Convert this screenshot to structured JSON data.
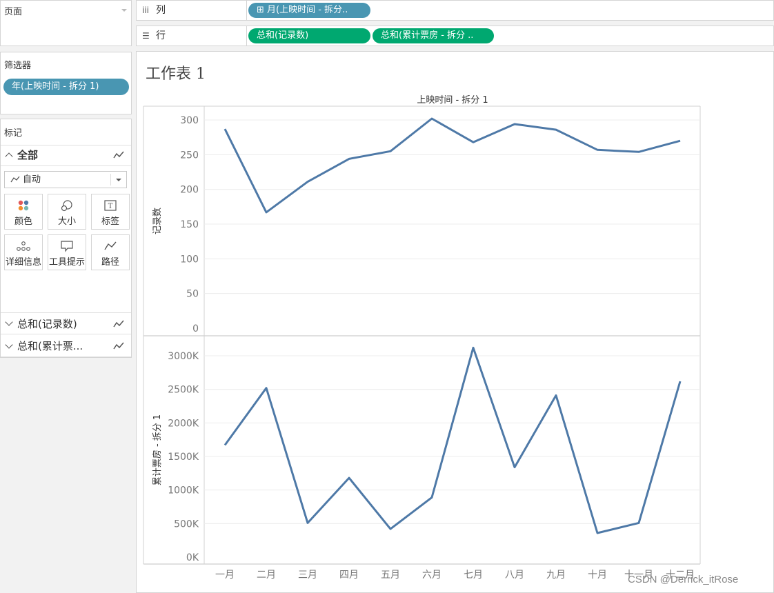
{
  "left_panel": {
    "pages_title": "页面",
    "filters_title": "筛选器",
    "filter_pill": "年(上映时间 - 拆分 1)",
    "marks_title": "标记",
    "all_label": "全部",
    "mark_type": "自动",
    "buttons": [
      "颜色",
      "大小",
      "标签",
      "详细信息",
      "工具提示",
      "路径"
    ],
    "measure_rows": [
      "总和(记录数)",
      "总和(累计票..."
    ]
  },
  "shelves": {
    "columns_label": "列",
    "columns_pill": "月(上映时间 - 拆分..",
    "rows_label": "行",
    "rows_pills": [
      "总和(记录数)",
      "总和(累计票房 - 拆分 .."
    ]
  },
  "sheet": {
    "title": "工作表 1",
    "header": "上映时间 - 拆分 1"
  },
  "chart_data": [
    {
      "type": "line",
      "categories": [
        "一月",
        "二月",
        "三月",
        "四月",
        "五月",
        "六月",
        "七月",
        "八月",
        "九月",
        "十月",
        "十一月",
        "十二月"
      ],
      "values": [
        287,
        167,
        211,
        244,
        255,
        302,
        268,
        294,
        286,
        257,
        254,
        270
      ],
      "ylabel": "记录数",
      "yticks": [
        0,
        50,
        100,
        150,
        200,
        250,
        300
      ],
      "ylim": [
        0,
        320
      ],
      "color": "#4e79a7"
    },
    {
      "type": "line",
      "categories": [
        "一月",
        "二月",
        "三月",
        "四月",
        "五月",
        "六月",
        "七月",
        "八月",
        "九月",
        "十月",
        "十一月",
        "十二月"
      ],
      "values": [
        1670000,
        2520000,
        510000,
        1180000,
        420000,
        890000,
        3120000,
        1340000,
        2410000,
        360000,
        510000,
        2620000
      ],
      "ylabel": "累计票房 - 拆分 1",
      "yticks": [
        "0K",
        "500K",
        "1000K",
        "1500K",
        "2000K",
        "2500K",
        "3000K"
      ],
      "ylim": [
        0,
        3250000
      ],
      "color": "#4e79a7"
    }
  ],
  "watermark": "CSDN @Derrick_itRose"
}
